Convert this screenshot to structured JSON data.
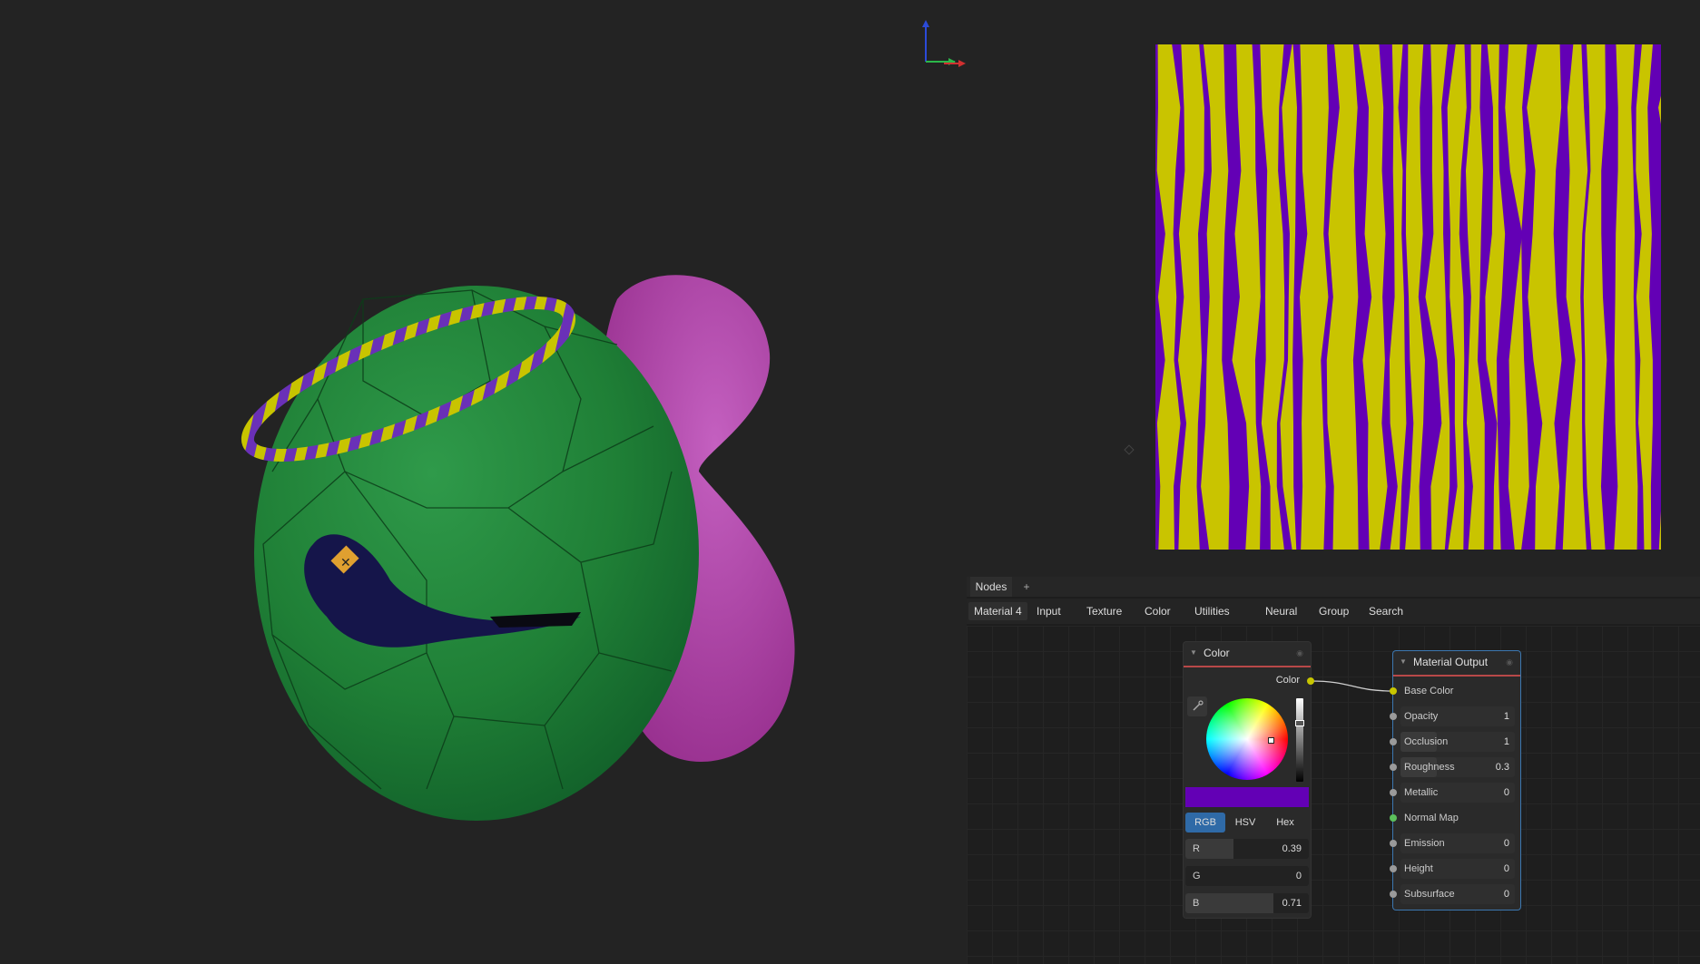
{
  "panel": {
    "tab_nodes": "Nodes",
    "tab_add": "+",
    "categories": [
      "Material 4",
      "Input",
      "Texture",
      "Color",
      "Utilities",
      "Neural",
      "Group",
      "Search"
    ]
  },
  "color_node": {
    "title": "Color",
    "output_label": "Color",
    "swatch_color": "#6300b5",
    "modes": [
      "RGB",
      "HSV",
      "Hex"
    ],
    "active_mode": "RGB",
    "channels": [
      {
        "label": "R",
        "value": "0.39"
      },
      {
        "label": "G",
        "value": "0"
      },
      {
        "label": "B",
        "value": "0.71"
      }
    ]
  },
  "output_node": {
    "title": "Material Output",
    "inputs": [
      {
        "label": "Base Color",
        "value": "",
        "socket": "#c8c600"
      },
      {
        "label": "Opacity",
        "value": "1",
        "socket": "#9a9a9a"
      },
      {
        "label": "Occlusion",
        "value": "1",
        "socket": "#9a9a9a"
      },
      {
        "label": "Roughness",
        "value": "0.3",
        "socket": "#9a9a9a"
      },
      {
        "label": "Metallic",
        "value": "0",
        "socket": "#9a9a9a"
      },
      {
        "label": "Normal Map",
        "value": "",
        "socket": "#5cc05c"
      },
      {
        "label": "Emission",
        "value": "0",
        "socket": "#9a9a9a"
      },
      {
        "label": "Height",
        "value": "0",
        "socket": "#9a9a9a"
      },
      {
        "label": "Subsurface",
        "value": "0",
        "socket": "#9a9a9a"
      }
    ]
  },
  "texture_colors": {
    "primary": "#6300b5",
    "secondary": "#c9c400"
  }
}
